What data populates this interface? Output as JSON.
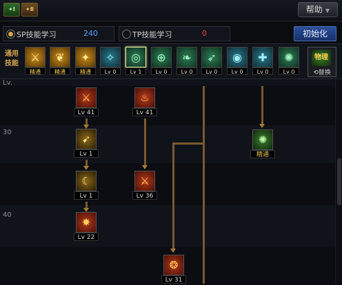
{
  "header": {
    "tabs": [
      "✦Ⅰ",
      "✦Ⅱ"
    ],
    "help_label": "帮助",
    "help_arrow": "▼"
  },
  "points": {
    "sp_label": "SP技能学习",
    "sp_value": "240",
    "tp_label": "TP技能学习",
    "tp_value": "0",
    "init_label": "初始化"
  },
  "common": {
    "label": "通用技能",
    "skills": [
      {
        "icon": "slash-icon",
        "glyph": "⚔",
        "level": "精通"
      },
      {
        "icon": "wing-icon",
        "glyph": "❦",
        "level": "精通"
      },
      {
        "icon": "fighter-icon",
        "glyph": "✦",
        "level": "精通"
      },
      {
        "icon": "crystal-icon",
        "glyph": "✧",
        "level": "Lv 0"
      },
      {
        "icon": "target-icon",
        "glyph": "◎",
        "level": "Lv 1"
      },
      {
        "icon": "radar-icon",
        "glyph": "⊕",
        "level": "Lv 0"
      },
      {
        "icon": "leaf-icon",
        "glyph": "❧",
        "level": "Lv 0"
      },
      {
        "icon": "dash-icon",
        "glyph": "➶",
        "level": "Lv 0"
      },
      {
        "icon": "orb-icon",
        "glyph": "◉",
        "level": "Lv 0"
      },
      {
        "icon": "guard-icon",
        "glyph": "✚",
        "level": "Lv 0"
      },
      {
        "icon": "claw-icon",
        "glyph": "✺",
        "level": "Lv 0"
      }
    ],
    "swap_badge": "物理",
    "swap_label": "⟲替换"
  },
  "tree": {
    "levels": [
      "Lv.",
      "30",
      "40"
    ],
    "skills": [
      {
        "icon": "fire-slash-icon",
        "glyph": "⚔",
        "level": "Lv 41"
      },
      {
        "icon": "blade-icon",
        "glyph": "➹",
        "level": "Lv 1"
      },
      {
        "icon": "crescent-icon",
        "glyph": "☾",
        "level": "Lv 1"
      },
      {
        "icon": "star-burst-icon",
        "glyph": "✸",
        "level": "Lv 22"
      },
      {
        "icon": "flame-icon",
        "glyph": "♨",
        "level": "Lv 41"
      },
      {
        "icon": "sword-fire-icon",
        "glyph": "⚔",
        "level": "Lv 36"
      },
      {
        "icon": "dragon-icon",
        "glyph": "❂",
        "level": "Lv 31"
      },
      {
        "icon": "claw-green-icon",
        "glyph": "✺",
        "level": "精通"
      }
    ]
  }
}
